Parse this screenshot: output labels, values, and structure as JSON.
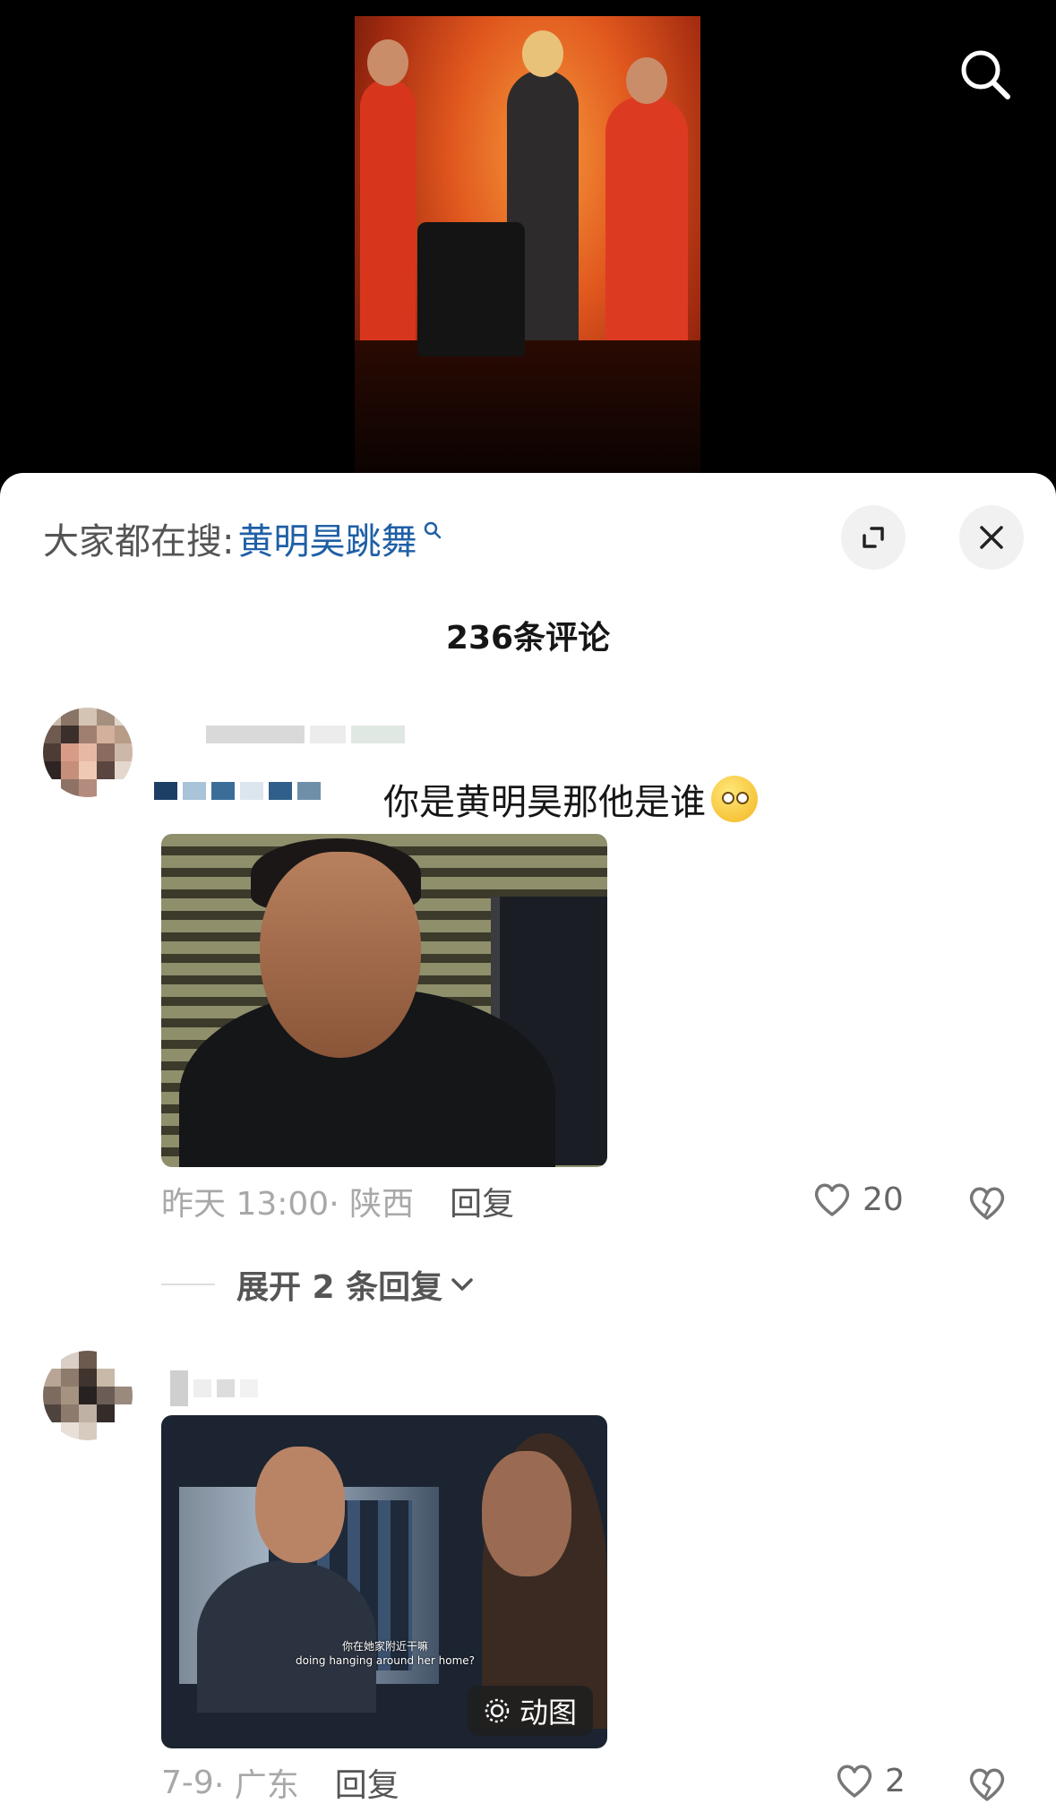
{
  "search_suggestion": {
    "prefix": "大家都在搜:",
    "term": "黄明昊跳舞"
  },
  "comments_header": {
    "count_text": "236条评论"
  },
  "comments": [
    {
      "text": "你是黄明昊那他是谁",
      "time": "昨天 13:00",
      "location": "· 陕西",
      "reply_label": "回复",
      "likes": "20"
    },
    {
      "time": "7-9",
      "location": "· 广东",
      "reply_label": "回复",
      "likes": "2",
      "gif_badge": "动图",
      "subtitle_zh": "你在她家附近干嘛",
      "subtitle_en": "doing hanging around her home?"
    }
  ],
  "expand_replies": {
    "label": "展开 2 条回复"
  },
  "colors": {
    "search_term": "#1f5fa6",
    "meta_gray": "#a8a8a8"
  },
  "icons": {
    "top_search": "search-icon",
    "expand": "expand-icon",
    "close": "close-icon",
    "like": "heart-icon",
    "dislike": "broken-heart-icon",
    "gif": "gif-icon",
    "chevron": "chevron-down-icon"
  }
}
